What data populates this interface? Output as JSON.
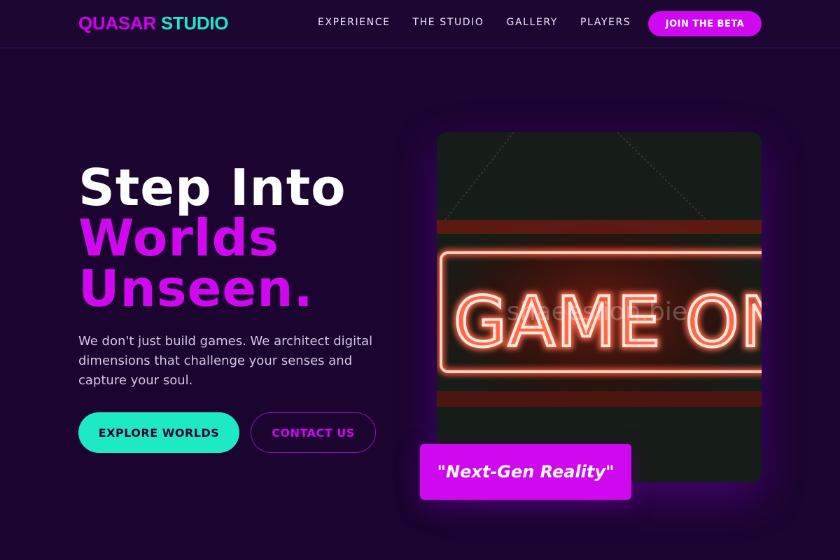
{
  "header": {
    "logo_part1": "QUASAR",
    "logo_part2": "STUDIO",
    "nav": [
      "EXPERIENCE",
      "THE STUDIO",
      "GALLERY",
      "PLAYERS"
    ],
    "cta": "JOIN THE BETA"
  },
  "hero": {
    "title_line1": "Step Into",
    "title_line2": "Worlds",
    "title_line3": "Unseen.",
    "description": "We don't just build games. We architect digital dimensions that challenge your senses and capture your soul.",
    "primary_button": "EXPLORE WORLDS",
    "secondary_button": "CONTACT US"
  },
  "image": {
    "sign_text": "GAME ON",
    "watermark": "shaeeslion.bie",
    "icon": "neon-sign-image"
  },
  "badge": {
    "text": "\"Next-Gen Reality\""
  },
  "colors": {
    "background": "#1b0430",
    "accent_magenta": "#cf08f0",
    "accent_teal": "#1de9c4",
    "neon_red": "#ff3a1e"
  }
}
